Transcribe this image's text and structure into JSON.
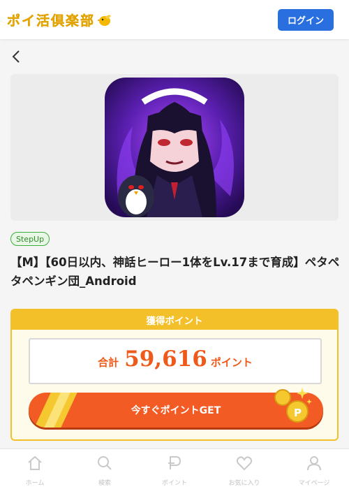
{
  "header": {
    "logo_text": "ポイ活倶楽部",
    "login_label": "ログイン"
  },
  "offer": {
    "badge": "StepUp",
    "title": "【M】【60日以内、神話ヒーロー1体をLv.17まで育成】ペタペタペンギン団_Android"
  },
  "points": {
    "header": "獲得ポイント",
    "total_label": "合計",
    "total_value": "59,616",
    "unit": "ポイント",
    "cta_label": "今すぐポイントGET"
  },
  "tabbar": [
    {
      "label": "ホーム",
      "icon": "home-icon"
    },
    {
      "label": "検索",
      "icon": "search-icon"
    },
    {
      "label": "ポイント",
      "icon": "points-icon"
    },
    {
      "label": "お気に入り",
      "icon": "heart-icon"
    },
    {
      "label": "マイページ",
      "icon": "user-icon"
    }
  ],
  "colors": {
    "brand_yellow": "#f4c02a",
    "login_blue": "#2a6fe0",
    "cta_orange": "#f35b24",
    "badge_green": "#3cae3c"
  }
}
